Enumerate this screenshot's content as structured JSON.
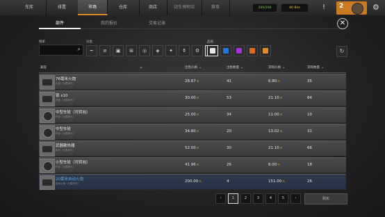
{
  "topnav": {
    "tabs": [
      {
        "label": "车库"
      },
      {
        "label": "排置"
      },
      {
        "label": "市场"
      },
      {
        "label": "仓库"
      },
      {
        "label": "商店"
      },
      {
        "label": "战车博物馆"
      },
      {
        "label": "赛事"
      }
    ],
    "currency1": "200/200",
    "currency2": "80 Bits",
    "level": "2"
  },
  "subtabs": [
    "部件",
    "我的报价",
    "交易记录"
  ],
  "filters": {
    "search_label": "搜索",
    "category_label": "分类",
    "rarity_label": "品质",
    "category_icons": [
      "weapon-icon",
      "gun-icon",
      "cabin-icon",
      "engine-icon",
      "wheel-icon",
      "module-icon",
      "decor-icon",
      "bottle-icon",
      "gear-icon",
      "all-icon"
    ],
    "rarity_colors": [
      "#e8e8e8",
      "#2d74d8",
      "#a234cf",
      "#e06a1f",
      "#e68a2e"
    ]
  },
  "table": {
    "headers": [
      "兼容",
      "出售价格",
      "出售数量",
      "求购价格",
      "求购数量"
    ],
    "rows": [
      {
        "name": "76毫米火炮",
        "sub": "大炮（已模块化）",
        "sell_price": "28.87",
        "sell_qty": "41",
        "buy_price": "6.80",
        "buy_qty": "35",
        "kind": "gun"
      },
      {
        "name": "锁 x10",
        "sub": "资源（已模块化）",
        "sell_price": "30.00",
        "sell_qty": "53",
        "buy_price": "21.10",
        "buy_qty": "84",
        "kind": "block"
      },
      {
        "name": "中型车轮（可转向）",
        "sub": "车轮（已模块化）",
        "sell_price": "25.00",
        "sell_qty": "34",
        "buy_price": "11.00",
        "buy_qty": "10",
        "kind": "wheel"
      },
      {
        "name": "中型车轮",
        "sub": "车轮（已模块化）",
        "sell_price": "34.80",
        "sell_qty": "20",
        "buy_price": "13.02",
        "buy_qty": "31",
        "kind": "wheel"
      },
      {
        "name": "武器散热器",
        "sub": "模块（已模块化）",
        "sell_price": "52.00",
        "sell_qty": "30",
        "buy_price": "21.10",
        "buy_qty": "66",
        "kind": "block"
      },
      {
        "name": "小型车轮（可转向）",
        "sub": "车轮（已模块化）",
        "sell_price": "41.96",
        "sell_qty": "26",
        "buy_price": "6.00",
        "buy_qty": "18",
        "kind": "wheel"
      },
      {
        "name": "20毫米自动火炮",
        "sub": "自动火炮（已模块化）",
        "sell_price": "200.00",
        "sell_qty": "4",
        "buy_price": "151.00",
        "buy_qty": "26",
        "kind": "gun",
        "highlight": true
      }
    ]
  },
  "pagination": {
    "pages": [
      "1",
      "2",
      "3",
      "4",
      "5"
    ],
    "current": "1"
  },
  "action_button": "购买",
  "currency_symbol": "币"
}
